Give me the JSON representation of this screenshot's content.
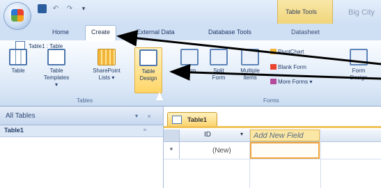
{
  "window": {
    "context_tab_group": "Table Tools",
    "doc_title": "Big City"
  },
  "quick_access": {
    "save_icon": "save-icon",
    "undo_icon": "undo-icon",
    "redo_icon": "redo-icon",
    "customize": "▾"
  },
  "ribbon_tabs": [
    "Home",
    "Create",
    "External Data",
    "Database Tools",
    "Datasheet"
  ],
  "active_tab": "Create",
  "tables_group": {
    "label": "Tables",
    "buttons": [
      {
        "label": "Table",
        "icon": "table-icon"
      },
      {
        "label": "Table\nTemplates ▾",
        "icon": "table-templates-icon"
      },
      {
        "label": "SharePoint\nLists ▾",
        "icon": "sharepoint-lists-icon"
      },
      {
        "label": "Table\nDesign",
        "icon": "table-design-icon"
      }
    ]
  },
  "forms_group": {
    "label": "Forms",
    "buttons": [
      {
        "label": "Form",
        "icon": "form-icon"
      },
      {
        "label": "Split\nForm",
        "icon": "split-form-icon"
      },
      {
        "label": "Multiple\nItems",
        "icon": "multiple-items-icon"
      },
      {
        "label": "Form\nDesign",
        "icon": "form-design-icon"
      }
    ],
    "small_buttons": [
      {
        "label": "PivotChart",
        "icon": "pivotchart-icon"
      },
      {
        "label": "Blank Form",
        "icon": "blank-form-icon"
      },
      {
        "label": "More Forms ▾",
        "icon": "more-forms-icon"
      }
    ]
  },
  "nav_pane": {
    "header": "All Tables",
    "group": "Table1",
    "items": [
      "Table1 : Table"
    ]
  },
  "document": {
    "tab": "Table1",
    "columns": [
      "ID",
      "Add New Field"
    ],
    "rows": [
      {
        "selector": "*",
        "id": "(New)"
      }
    ]
  },
  "colors": {
    "ribbon_bg": "#dbe8f7",
    "highlight": "#ffd566",
    "active_doc_tab": "#fbd36d",
    "arrow": "#000000"
  }
}
